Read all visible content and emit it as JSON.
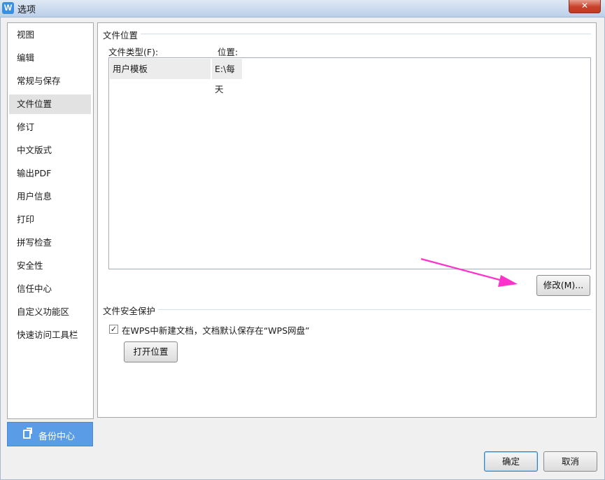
{
  "window": {
    "title": "选项",
    "app_icon_letter": "W",
    "close_symbol": "✕"
  },
  "sidebar": {
    "items": [
      {
        "label": "视图"
      },
      {
        "label": "编辑"
      },
      {
        "label": "常规与保存"
      },
      {
        "label": "文件位置"
      },
      {
        "label": "修订"
      },
      {
        "label": "中文版式"
      },
      {
        "label": "输出PDF"
      },
      {
        "label": "用户信息"
      },
      {
        "label": "打印"
      },
      {
        "label": "拼写检查"
      },
      {
        "label": "安全性"
      },
      {
        "label": "信任中心"
      },
      {
        "label": "自定义功能区"
      },
      {
        "label": "快速访问工具栏"
      }
    ],
    "active_index": 3,
    "backup_label": "备份中心"
  },
  "file_location": {
    "section_title": "文件位置",
    "col_type_label": "文件类型(F):",
    "col_location_label": "位置:",
    "rows": [
      {
        "type": "用户模板",
        "location": "E:\\每天"
      }
    ],
    "modify_button": "修改(M)..."
  },
  "file_security": {
    "section_title": "文件安全保护",
    "checkbox_checked": true,
    "checkbox_label": "在WPS中新建文档，文档默认保存在“WPS网盘”",
    "open_location_button": "打开位置"
  },
  "footer": {
    "ok_button": "确定",
    "cancel_button": "取消"
  },
  "colors": {
    "accent_backup": "#5b9ce6",
    "arrow": "#ff33cc",
    "close_button": "#c8412a"
  }
}
